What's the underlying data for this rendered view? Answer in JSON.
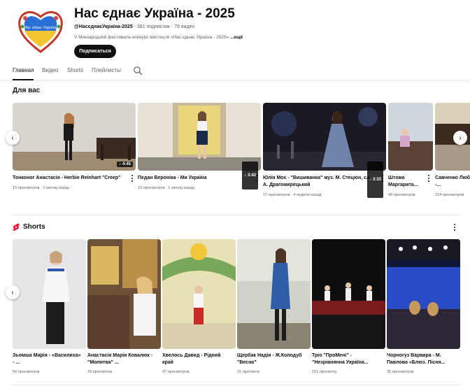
{
  "channel": {
    "title": "Нас єднає Україна - 2025",
    "handle": "@НасєднаєУкраїна-2025",
    "subscribers": "381 подписчик",
    "videos": "76 видео",
    "description": "V Міжнародний фестиваль-конкурс мистецтв «Нас єднає Україна - 2025»",
    "more": "...ещё",
    "subscribe": "Подписаться",
    "avatar_text": "Нас єднає Україна",
    "separator": "·"
  },
  "tabs": [
    "Главная",
    "Видео",
    "Shorts",
    "Плейлисты"
  ],
  "for_you": {
    "title": "Для вас",
    "videos": [
      {
        "title": "Тонконог Анастасія - Herbie Reinhart \"Creep\"",
        "views": "15 просмотров",
        "age": "1 месяц назад",
        "duration": "4:45"
      },
      {
        "title": "Педан Вероніка - Ми Україна",
        "views": "15 просмотров",
        "age": "1 месяц назад",
        "duration": "3:42"
      },
      {
        "title": "Юлія Мох - \"Вишиванка\" муз. М. Стецюн, сл. А. Драгомирецький",
        "views": "17 просмотров",
        "age": "4 недели назад",
        "duration": "3:33"
      },
      {
        "title": "Штома Маргарита...",
        "views": "49 просмотров",
        "age": ""
      },
      {
        "title": "Савченко Любов -...",
        "views": "154 просмотров",
        "age": ""
      }
    ]
  },
  "shorts": {
    "title": "Shorts",
    "items": [
      {
        "title": "Зьомша Марія - «Василиха» - ...",
        "views": "56 просмотров"
      },
      {
        "title": "Анастасія Марія Ковалюк - \"Молитва\" ...",
        "views": "32 просмотра"
      },
      {
        "title": "Хвелось Давид - Рідний край",
        "views": "47 просмотров"
      },
      {
        "title": "Щербак Надія - Ж.Колодуб \"Весна\"",
        "views": "21 просмотр"
      },
      {
        "title": "Тріо \"ПроМені\" - \"Незрівнянна Україна...",
        "views": "151 просмотр"
      },
      {
        "title": "Чорногуз Варвара - М. Павлова «Блюз. Пісня...",
        "views": "35 просмотров"
      }
    ]
  },
  "colors": {
    "accent_red": "#ff0033",
    "text": "#0f0f0f",
    "muted": "#606060"
  }
}
